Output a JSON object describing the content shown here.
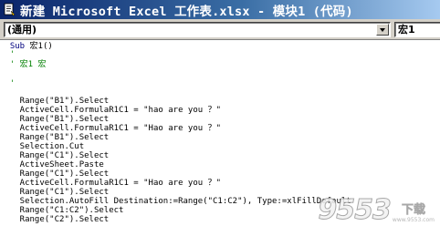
{
  "window": {
    "title": "新建 Microsoft Excel 工作表.xlsx - 模块1 (代码)",
    "icon": "vba-module-icon"
  },
  "selectors": {
    "object_value": "(通用)",
    "procedure_value": "宏1"
  },
  "code": {
    "sub_keyword": "Sub",
    "sub_name": " 宏1()",
    "comment_1": "'",
    "comment_2": "' 宏1 宏",
    "comment_3": "'",
    "lines": [
      "    Range(\"B1\").Select",
      "    ActiveCell.FormulaR1C1 = \"hao are you ？\"",
      "    Range(\"B1\").Select",
      "    ActiveCell.FormulaR1C1 = \"Hao are you ？\"",
      "    Range(\"B1\").Select",
      "    Selection.Cut",
      "    Range(\"C1\").Select",
      "    ActiveSheet.Paste",
      "    Range(\"C1\").Select",
      "    ActiveCell.FormulaR1C1 = \"Hao are you ？\"",
      "    Range(\"C1\").Select",
      "    Selection.AutoFill Destination:=Range(\"C1:C2\"), Type:=xlFillDefault",
      "    Range(\"C1:C2\").Select",
      "    Range(\"C2\").Select"
    ]
  },
  "watermark": {
    "number": "9553",
    "label": "下载",
    "url": "www.9553.com"
  },
  "colors": {
    "title_start": "#0a246a",
    "title_end": "#a6caf0",
    "keyword": "#00007f",
    "comment": "#007f00",
    "chrome": "#d4d0c8"
  }
}
